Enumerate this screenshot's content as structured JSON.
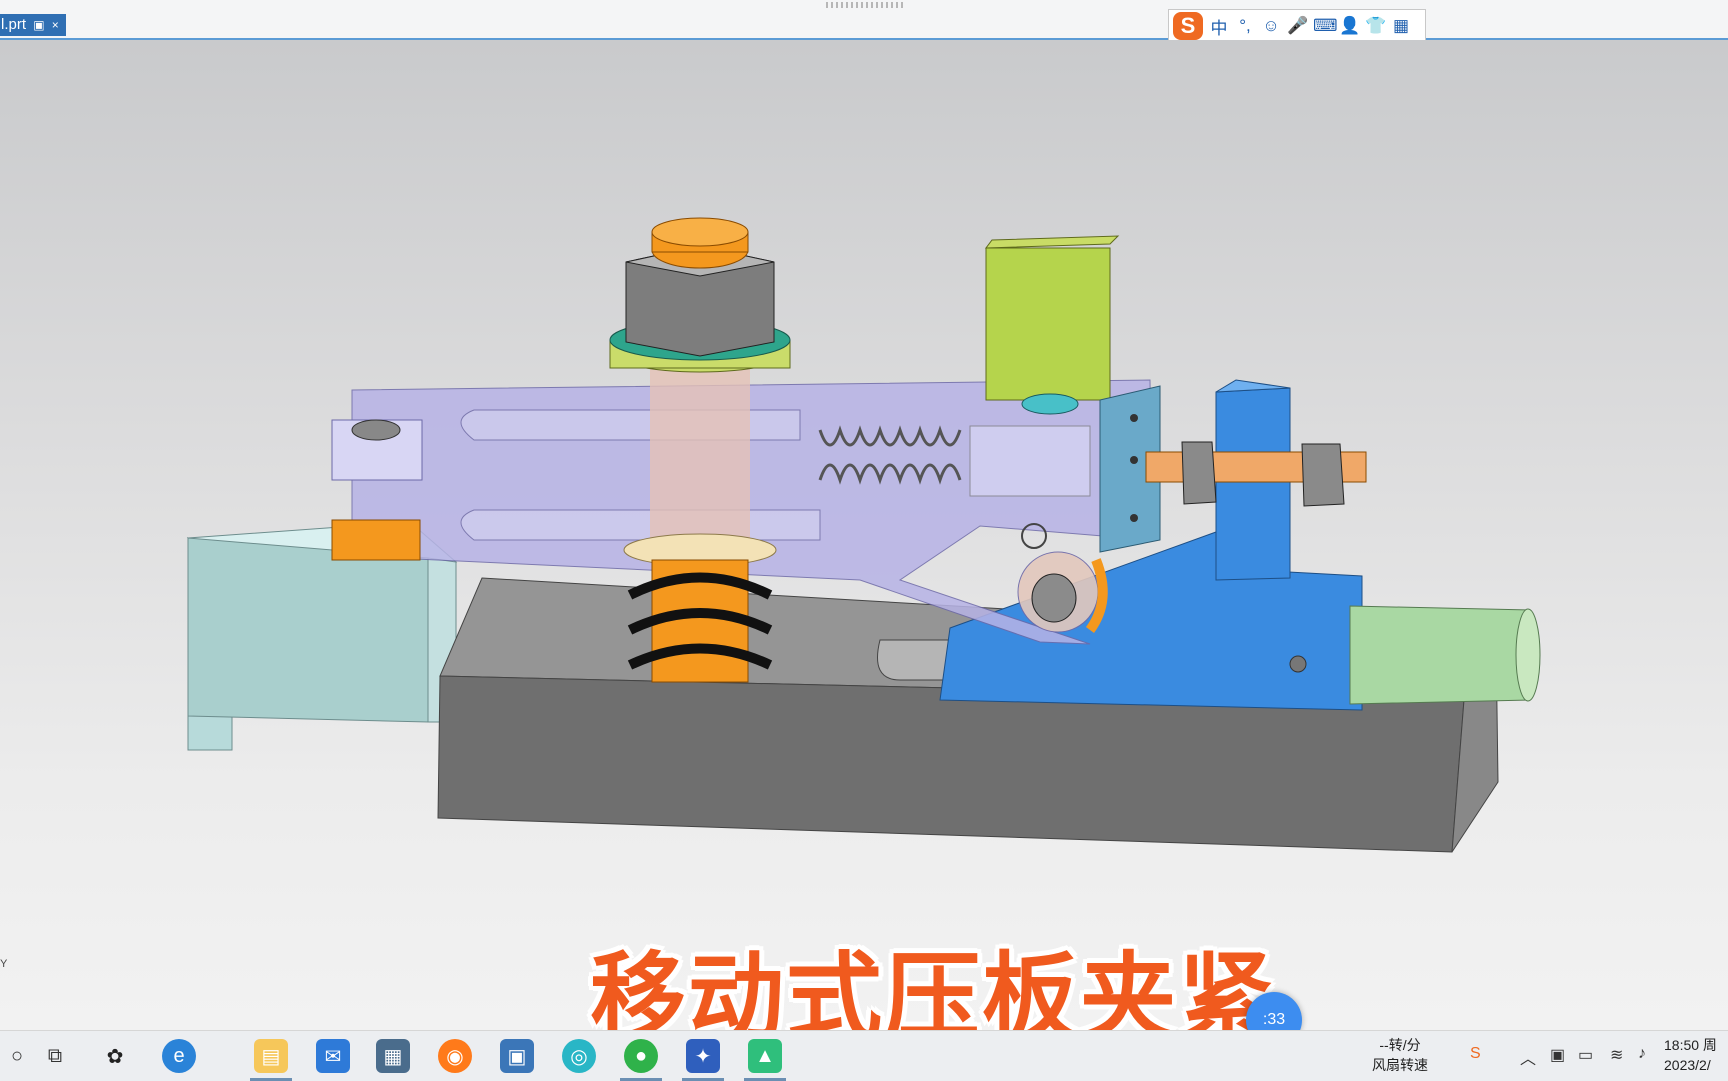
{
  "window": {
    "tab_label": "l.prt",
    "tab_close": "×"
  },
  "ime_toolbar": {
    "logo": "S",
    "items": [
      "中",
      "°,",
      "☺",
      "🎤",
      "⌨",
      "👤",
      "👕",
      "▦"
    ]
  },
  "viewport": {
    "axis_label": "Y",
    "caption": "移动式压板夹紧",
    "timer": ":33"
  },
  "taskbar": {
    "fan_speed": "--转/分",
    "fan_label": "风扇转速",
    "clock_time": "18:50 周",
    "clock_date": "2023/2/"
  },
  "colors": {
    "accent": "#2f6fb3",
    "caption": "#f05a1e",
    "clamp_plate": "#b7b3e6",
    "base": "#7d7d7d",
    "bracket": "#3a8be0",
    "nut_orange": "#f4981e"
  }
}
